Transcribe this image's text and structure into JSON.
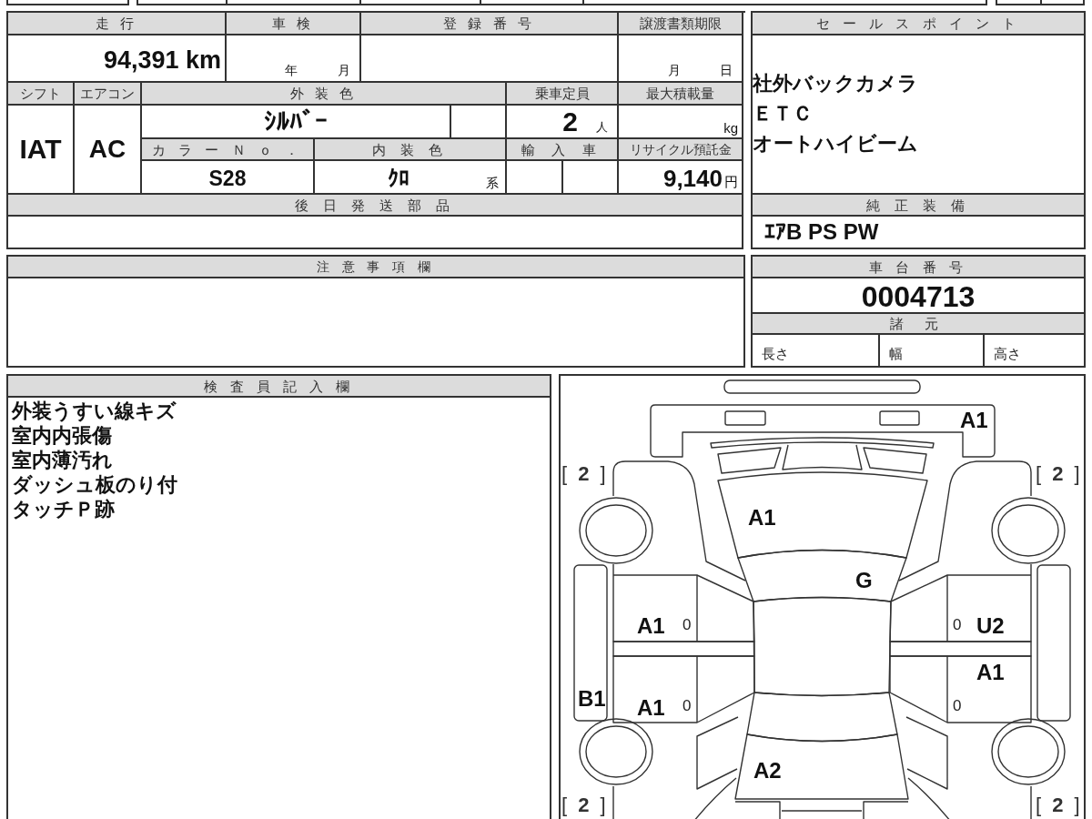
{
  "vehicle_info": {
    "mileage": {
      "label": "走 行",
      "value": "94,391 km"
    },
    "inspection": {
      "label": "車 検",
      "units": [
        "年",
        "月"
      ]
    },
    "registration_number": {
      "label": "登 録 番 号"
    },
    "transfer_deadline": {
      "label": "譲渡書類期限",
      "units": [
        "月",
        "日"
      ]
    },
    "shift": {
      "label": "シフト",
      "value": "IAT"
    },
    "air_conditioner": {
      "label": "エアコン",
      "value": "AC"
    },
    "exterior_color": {
      "label": "外 装 色",
      "value": "ｼﾙﾊﾞｰ"
    },
    "capacity": {
      "label": "乗車定員",
      "value": "2",
      "unit": "人"
    },
    "max_load": {
      "label": "最大積載量",
      "unit": "kg"
    },
    "color_number": {
      "label": "カ ラ ー Ｎ ｏ ．",
      "value": "S28"
    },
    "interior_color": {
      "label": "内 装 色",
      "value": "ｸﾛ",
      "unit": "系"
    },
    "imported": {
      "label": "輸 入 車"
    },
    "recycle_deposit": {
      "label": "リサイクル預託金",
      "value": "9,140",
      "unit": "円"
    },
    "later_shipped_parts": {
      "label": "後 日 発 送 部 品"
    }
  },
  "sales_points": {
    "label": "セ ー ル ス ポ イ ン ト",
    "items": [
      "社外バックカメラ",
      "ＥＴＣ",
      "オートハイビーム"
    ]
  },
  "standard_equipment": {
    "label": "純 正 装 備",
    "value": "ｴｱB PS PW"
  },
  "notes": {
    "label": "注 意 事 項 欄"
  },
  "chassis_number": {
    "label": "車 台 番 号",
    "value": "0004713"
  },
  "specifications": {
    "label": "諸 元",
    "items": [
      "長さ",
      "幅",
      "高さ"
    ]
  },
  "inspector_remarks": {
    "label": "検 査 員 記 入 欄",
    "lines": [
      "外装うすい線キズ",
      "室内内張傷",
      "室内薄汚れ",
      "ダッシュ板のり付",
      "タッチＰ跡"
    ]
  },
  "condition_diagram": {
    "front_panel": {
      "kind": "damage",
      "text": "A1"
    },
    "tire_front_left": {
      "kind": "tire",
      "text": "[ **2** ]"
    },
    "tire_front_right": {
      "kind": "tire",
      "text": "[ **2** ]"
    },
    "windshield": {
      "kind": "damage",
      "text": "A1"
    },
    "roof_front": {
      "kind": "damage",
      "text": "G"
    },
    "left_front_door": {
      "kind": "damage",
      "text": "A1"
    },
    "left_front_door_edge": {
      "kind": "edge",
      "text": "0"
    },
    "right_front_door_edge": {
      "kind": "edge",
      "text": "0"
    },
    "right_front_door": {
      "kind": "damage",
      "text": "U2"
    },
    "right_rear_door": {
      "kind": "damage",
      "text": "A1"
    },
    "left_side_strip": {
      "kind": "damage",
      "text": "B1"
    },
    "left_rear_door": {
      "kind": "damage",
      "text": "A1"
    },
    "left_rear_door_edge": {
      "kind": "edge",
      "text": "0"
    },
    "right_rear_door_edge": {
      "kind": "edge",
      "text": "0"
    },
    "trunk": {
      "kind": "damage",
      "text": "A2"
    },
    "tire_rear_left": {
      "kind": "tire",
      "text": "[ **2** ]"
    },
    "tire_rear_right": {
      "kind": "tire",
      "text": "[ **2** ]"
    }
  }
}
